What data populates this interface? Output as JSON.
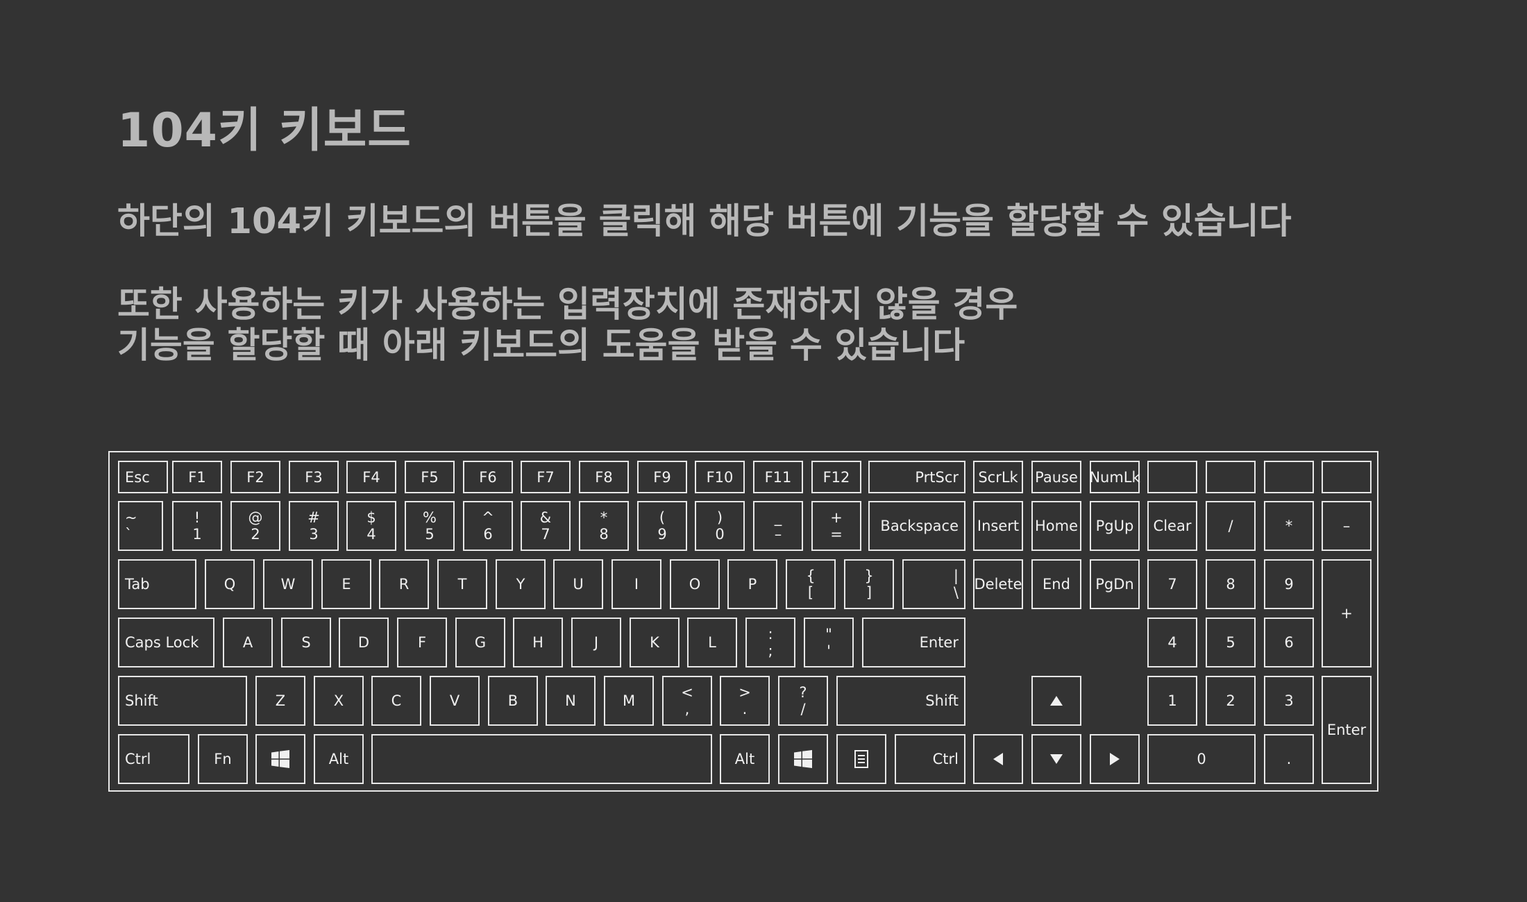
{
  "header": {
    "title": "104키 키보드",
    "desc1": "하단의 104키 키보드의 버튼을 클릭해 해당 버튼에 기능을 할당할 수 있습니다",
    "desc2": "또한 사용하는 키가 사용하는 입력장치에 존재하지 않을 경우",
    "desc3": "기능을 할당할 때 아래 키보드의 도움을 받을 수 있습니다"
  },
  "colors": {
    "background": "#333333",
    "text": "#b8b8b8",
    "key_border": "#e8e8e8"
  },
  "keyboard": {
    "row1": {
      "esc": "Esc",
      "f1": "F1",
      "f2": "F2",
      "f3": "F3",
      "f4": "F4",
      "f5": "F5",
      "f6": "F6",
      "f7": "F7",
      "f8": "F8",
      "f9": "F9",
      "f10": "F10",
      "f11": "F11",
      "f12": "F12",
      "prtscr": "PrtScr",
      "scrlk": "ScrLk",
      "pause": "Pause",
      "numlk": "NumLk"
    },
    "row2": {
      "tilde_top": "~",
      "tilde_bottom": "`",
      "k1_top": "!",
      "k1_bottom": "1",
      "k2_top": "@",
      "k2_bottom": "2",
      "k3_top": "#",
      "k3_bottom": "3",
      "k4_top": "$",
      "k4_bottom": "4",
      "k5_top": "%",
      "k5_bottom": "5",
      "k6_top": "^",
      "k6_bottom": "6",
      "k7_top": "&",
      "k7_bottom": "7",
      "k8_top": "*",
      "k8_bottom": "8",
      "k9_top": "(",
      "k9_bottom": "9",
      "k0_top": ")",
      "k0_bottom": "0",
      "minus_top": "_",
      "minus_bottom": "–",
      "equal_top": "+",
      "equal_bottom": "=",
      "backspace": "Backspace",
      "insert": "Insert",
      "home": "Home",
      "pgup": "PgUp",
      "clear": "Clear",
      "np_slash": "/",
      "np_star": "*",
      "np_minus": "–"
    },
    "row3": {
      "tab": "Tab",
      "q": "Q",
      "w": "W",
      "e": "E",
      "r": "R",
      "t": "T",
      "y": "Y",
      "u": "U",
      "i": "I",
      "o": "O",
      "p": "P",
      "lbracket_top": "{",
      "lbracket_bottom": "[",
      "rbracket_top": "}",
      "rbracket_bottom": "]",
      "backslash_top": "|",
      "backslash_bottom": "\\",
      "delete": "Delete",
      "end": "End",
      "pgdn": "PgDn",
      "np7": "7",
      "np8": "8",
      "np9": "9",
      "np_plus": "+"
    },
    "row4": {
      "capslock": "Caps Lock",
      "a": "A",
      "s": "S",
      "d": "D",
      "f": "F",
      "g": "G",
      "h": "H",
      "j": "J",
      "k": "K",
      "l": "L",
      "semicolon_top": ":",
      "semicolon_bottom": ";",
      "quote_top": "\"",
      "quote_bottom": "'",
      "enter": "Enter",
      "np4": "4",
      "np5": "5",
      "np6": "6"
    },
    "row5": {
      "lshift": "Shift",
      "z": "Z",
      "x": "X",
      "c": "C",
      "v": "V",
      "b": "B",
      "n": "N",
      "m": "M",
      "comma_top": "<",
      "comma_bottom": ",",
      "period_top": ">",
      "period_bottom": ".",
      "slash_top": "?",
      "slash_bottom": "/",
      "rshift": "Shift",
      "np1": "1",
      "np2": "2",
      "np3": "3",
      "np_enter": "Enter"
    },
    "row6": {
      "lctrl": "Ctrl",
      "fn": "Fn",
      "lalt": "Alt",
      "ralt": "Alt",
      "rctrl": "Ctrl",
      "np0": "0",
      "np_dot": "."
    },
    "icons": {
      "windows": "windows-icon",
      "menu": "menu-icon",
      "up": "arrow-up-icon",
      "down": "arrow-down-icon",
      "left": "arrow-left-icon",
      "right": "arrow-right-icon"
    }
  }
}
